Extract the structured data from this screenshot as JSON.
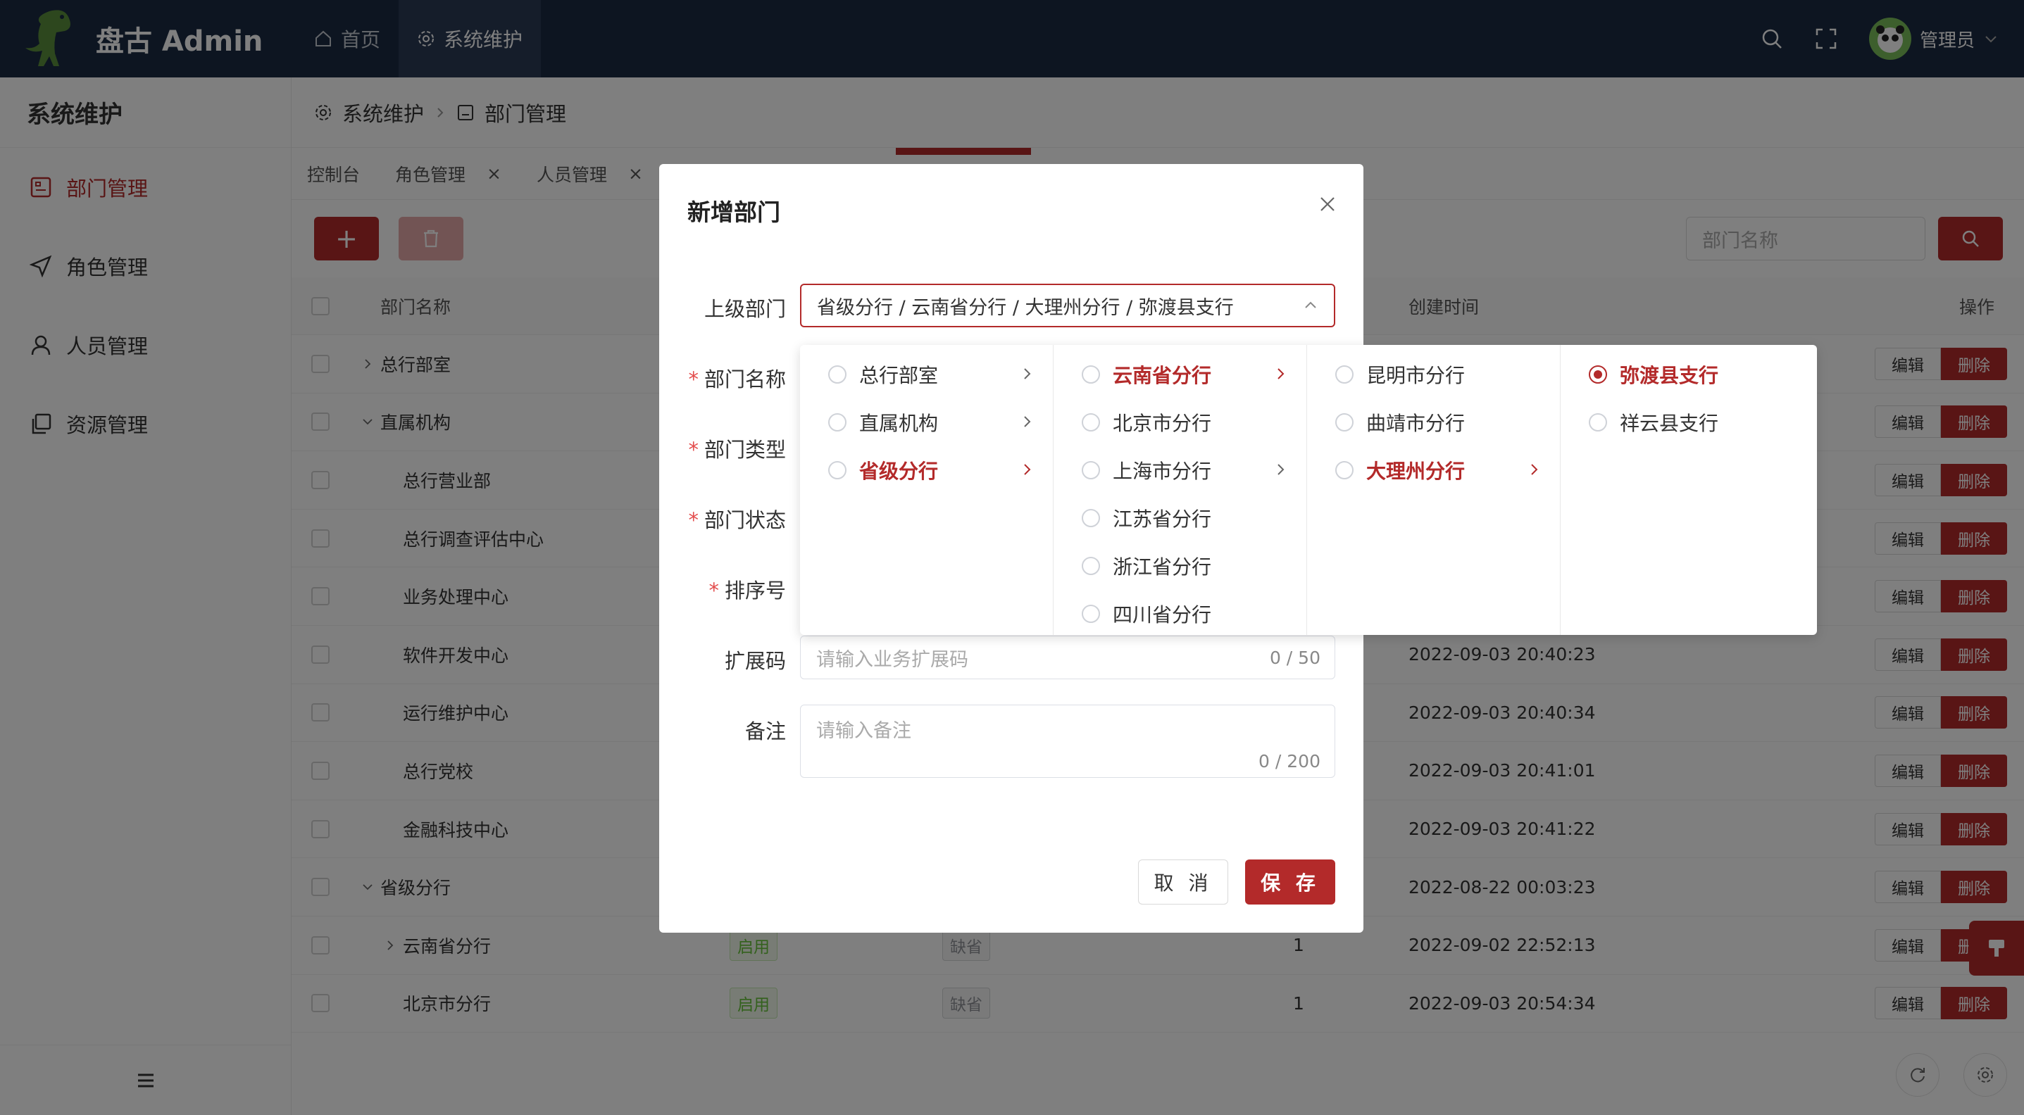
{
  "app": {
    "title": "盘古 Admin"
  },
  "topnav": {
    "home": "首页",
    "system": "系统维护",
    "user": "管理员"
  },
  "sidebar": {
    "title": "系统维护",
    "items": [
      {
        "label": "部门管理",
        "icon": "dept-icon",
        "active": true
      },
      {
        "label": "角色管理",
        "icon": "send-icon",
        "active": false
      },
      {
        "label": "人员管理",
        "icon": "user-icon",
        "active": false
      },
      {
        "label": "资源管理",
        "icon": "copy-icon",
        "active": false
      }
    ]
  },
  "breadcrumb": {
    "root": "系统维护",
    "current": "部门管理"
  },
  "tabs": [
    "控制台",
    "角色管理",
    "人员管理"
  ],
  "search": {
    "placeholder": "部门名称"
  },
  "table": {
    "headers": {
      "name": "部门名称",
      "created": "创建时间",
      "ops": "操作"
    },
    "edit": "编辑",
    "delete": "删除",
    "rows": [
      {
        "name": "总行部室",
        "status": "",
        "type": "",
        "order": "",
        "created": ""
      },
      {
        "name": "直属机构",
        "status": "",
        "type": "",
        "order": "",
        "created": ""
      },
      {
        "name": "总行营业部",
        "status": "",
        "type": "",
        "order": "",
        "created": ""
      },
      {
        "name": "总行调查评估中心",
        "status": "",
        "type": "",
        "order": "",
        "created": ""
      },
      {
        "name": "业务处理中心",
        "status": "",
        "type": "",
        "order": "",
        "created": ""
      },
      {
        "name": "软件开发中心",
        "status": "",
        "type": "",
        "order": "",
        "created": "2022-09-03 20:40:23"
      },
      {
        "name": "运行维护中心",
        "status": "",
        "type": "",
        "order": "",
        "created": "2022-09-03 20:40:34"
      },
      {
        "name": "总行党校",
        "status": "",
        "type": "",
        "order": "",
        "created": "2022-09-03 20:41:01"
      },
      {
        "name": "金融科技中心",
        "status": "",
        "type": "",
        "order": "",
        "created": "2022-09-03 20:41:22"
      },
      {
        "name": "省级分行",
        "status": "",
        "type": "",
        "order": "",
        "created": "2022-08-22 00:03:23"
      },
      {
        "name": "云南省分行",
        "status": "启用",
        "type": "缺省",
        "order": "1",
        "created": "2022-09-02 22:52:13"
      },
      {
        "name": "北京市分行",
        "status": "启用",
        "type": "缺省",
        "order": "1",
        "created": "2022-09-03 20:54:34"
      }
    ]
  },
  "dialog": {
    "title": "新增部门",
    "labels": {
      "parent": "上级部门",
      "name": "部门名称",
      "type": "部门类型",
      "status": "部门状态",
      "order": "排序号",
      "ext": "扩展码",
      "remark": "备注"
    },
    "parent_value": "省级分行 / 云南省分行 / 大理州分行 / 弥渡县支行",
    "ext_placeholder": "请输入业务扩展码",
    "ext_count": "0 / 50",
    "remark_placeholder": "请输入备注",
    "remark_count": "0 / 200",
    "cancel": "取 消",
    "save": "保 存"
  },
  "cascader": {
    "col1": [
      {
        "label": "总行部室",
        "arrow": true
      },
      {
        "label": "直属机构",
        "arrow": true
      },
      {
        "label": "省级分行",
        "arrow": true,
        "active": true
      }
    ],
    "col2": [
      {
        "label": "云南省分行",
        "arrow": true,
        "active": true
      },
      {
        "label": "北京市分行",
        "arrow": false
      },
      {
        "label": "上海市分行",
        "arrow": true
      },
      {
        "label": "江苏省分行",
        "arrow": false
      },
      {
        "label": "浙江省分行",
        "arrow": false
      },
      {
        "label": "四川省分行",
        "arrow": false
      }
    ],
    "col3": [
      {
        "label": "昆明市分行",
        "arrow": false
      },
      {
        "label": "曲靖市分行",
        "arrow": false
      },
      {
        "label": "大理州分行",
        "arrow": true,
        "active": true
      }
    ],
    "col4": [
      {
        "label": "弥渡县支行",
        "arrow": false,
        "active": true,
        "checked": true
      },
      {
        "label": "祥云县支行",
        "arrow": false
      }
    ]
  },
  "colors": {
    "primary": "#b32a2a",
    "header_bg": "#1b2a42"
  }
}
